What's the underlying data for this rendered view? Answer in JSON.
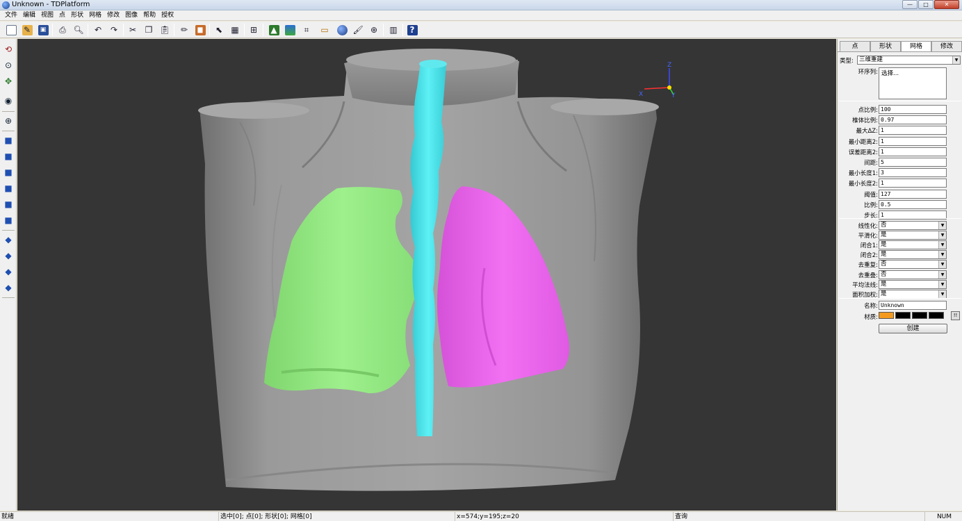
{
  "window": {
    "title": "Unknown - TDPlatform",
    "min": "—",
    "max": "□",
    "close": "✕"
  },
  "menu": [
    "文件",
    "编辑",
    "视图",
    "点",
    "形状",
    "网格",
    "修改",
    "图像",
    "帮助",
    "授权"
  ],
  "toolbar_icons": [
    "new-icon",
    "open-icon",
    "save-icon",
    "print-preview-icon",
    "zoom-preview-icon",
    "undo-icon",
    "redo-icon",
    "cut-icon",
    "copy-icon",
    "paste-icon",
    "pen-icon",
    "erase-icon",
    "select-icon",
    "grid-tool-icon",
    "fit-icon",
    "landscape-icon",
    "image-icon",
    "crop-icon",
    "measure-icon",
    "sphere-icon",
    "brush-icon",
    "target-icon",
    "ruler-icon",
    "help-icon"
  ],
  "left_tools": [
    "rotate-icon",
    "zoom-axis-icon",
    "pan-icon",
    "camera-icon",
    "zoom-icon",
    "view-front-icon",
    "view-back-icon",
    "view-left-icon",
    "view-right-icon",
    "view-top-icon",
    "view-bottom-icon",
    "cube-iso1-icon",
    "cube-iso2-icon",
    "cube-iso3-icon",
    "cube-iso4-icon"
  ],
  "viewport": {
    "axes": {
      "x": "X",
      "y": "Y",
      "z": "Z"
    },
    "colors": {
      "body": "#8e8e8e",
      "left_lung": "#99ee88",
      "right_lung": "#ee66ee",
      "trachea": "#44e6ee",
      "background": "#353535"
    }
  },
  "panel": {
    "tabs": [
      {
        "label": "点",
        "active": false
      },
      {
        "label": "形状",
        "active": false
      },
      {
        "label": "网格",
        "active": true
      },
      {
        "label": "修改",
        "active": false
      }
    ],
    "type_label": "类型:",
    "type_value": "三维重建",
    "ring_label": "环序列:",
    "ring_value": "选择...",
    "params": [
      {
        "label": "点比例:",
        "value": "100"
      },
      {
        "label": "椎体比例:",
        "value": "0.97"
      },
      {
        "label": "最大ΔZ:",
        "value": "1"
      },
      {
        "label": "最小距离2:",
        "value": "1"
      },
      {
        "label": "误差距离2:",
        "value": "1"
      },
      {
        "label": "间距:",
        "value": "5"
      },
      {
        "label": "最小长度1:",
        "value": "3"
      },
      {
        "label": "最小长度2:",
        "value": "1"
      },
      {
        "label": "阈值:",
        "value": "127"
      },
      {
        "label": "比例:",
        "value": "0.5"
      },
      {
        "label": "步长:",
        "value": "1"
      }
    ],
    "options": [
      {
        "label": "线性化:",
        "value": "否"
      },
      {
        "label": "平滑化:",
        "value": "是"
      },
      {
        "label": "闭合1:",
        "value": "是"
      },
      {
        "label": "闭合2:",
        "value": "是"
      },
      {
        "label": "去重复:",
        "value": "否"
      },
      {
        "label": "去重叠:",
        "value": "否"
      },
      {
        "label": "平均法线:",
        "value": "是"
      },
      {
        "label": "面积加权:",
        "value": "是"
      }
    ],
    "name_label": "名称:",
    "name_value": "Unknown",
    "material_label": "材质:",
    "material_colors": [
      "#f39a1e",
      "#000000",
      "#000000",
      "#000000"
    ],
    "material_button": "!!",
    "create_label": "创建"
  },
  "status": {
    "ready": "就绪",
    "selection": "选中[0]; 点[0]; 形状[0]; 网格[0]",
    "coords": "x=574;y=195;z=20",
    "query": "查询",
    "num": "NUM"
  }
}
